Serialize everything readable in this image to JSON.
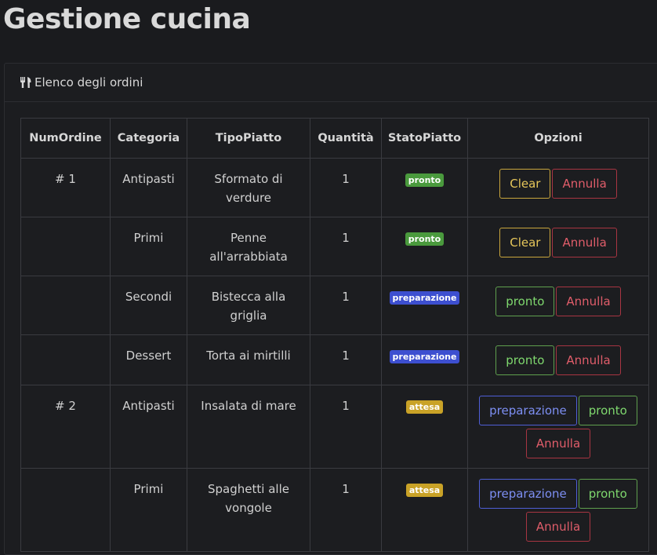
{
  "page": {
    "title": "Gestione cucina"
  },
  "card": {
    "header_icon": "utensils-icon",
    "header_label": "Elenco degli ordini"
  },
  "table": {
    "headers": [
      "NumOrdine",
      "Categoria",
      "TipoPiatto",
      "Quantità",
      "StatoPiatto",
      "Opzioni"
    ],
    "status_colors": {
      "pronto": "#4a9a3d",
      "preparazione": "#3d4fd0",
      "attesa": "#c9a227"
    },
    "groups": [
      {
        "num": "# 1",
        "rows": [
          {
            "categoria": "Antipasti",
            "tipo": "Sformato di verdure",
            "quantita": "1",
            "stato": "pronto",
            "options": [
              "Clear",
              "Annulla"
            ]
          },
          {
            "categoria": "Primi",
            "tipo": "Penne all'arrabbiata",
            "quantita": "1",
            "stato": "pronto",
            "options": [
              "Clear",
              "Annulla"
            ]
          },
          {
            "categoria": "Secondi",
            "tipo": "Bistecca alla griglia",
            "quantita": "1",
            "stato": "preparazione",
            "options": [
              "pronto",
              "Annulla"
            ]
          },
          {
            "categoria": "Dessert",
            "tipo": "Torta ai mirtilli",
            "quantita": "1",
            "stato": "preparazione",
            "options": [
              "pronto",
              "Annulla"
            ]
          }
        ]
      },
      {
        "num": "# 2",
        "rows": [
          {
            "categoria": "Antipasti",
            "tipo": "Insalata di mare",
            "quantita": "1",
            "stato": "attesa",
            "options": [
              "preparazione",
              "pronto",
              "Annulla"
            ]
          },
          {
            "categoria": "Primi",
            "tipo": "Spaghetti alle vongole",
            "quantita": "1",
            "stato": "attesa",
            "options": [
              "preparazione",
              "pronto",
              "Annulla"
            ]
          }
        ]
      }
    ]
  }
}
